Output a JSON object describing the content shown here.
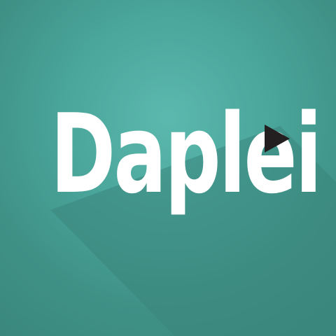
{
  "logo": {
    "text": "Daplei",
    "icon": "play-icon",
    "text_color": "#ffffff",
    "icon_color": "#231f20"
  },
  "background": {
    "color": "#4aa59a",
    "shadow_color": "#3a857b"
  }
}
